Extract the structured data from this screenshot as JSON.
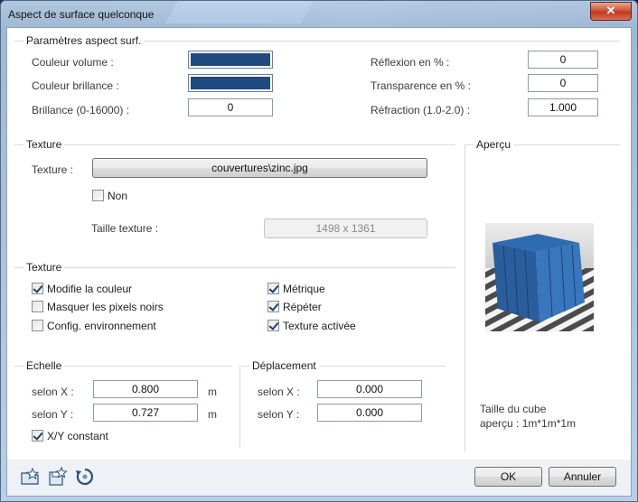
{
  "window": {
    "title": "Aspect de surface quelconque",
    "close_glyph": "✕"
  },
  "surface": {
    "group_title": "Paramètres aspect surf.",
    "couleur_volume_label": "Couleur volume :",
    "couleur_volume_color": "#1f4a7f",
    "couleur_brillance_label": "Couleur brillance :",
    "couleur_brillance_color": "#1f4a7f",
    "brillance_label": "Brillance (0-16000) :",
    "brillance_value": "0",
    "reflexion_label": "Réflexion en % :",
    "reflexion_value": "0",
    "transparence_label": "Transparence en % :",
    "transparence_value": "0",
    "refraction_label": "Réfraction (1.0-2.0) :",
    "refraction_value": "1.000"
  },
  "texture_file": {
    "group_title": "Texture",
    "texture_label": "Texture :",
    "texture_button": "couvertures\\zinc.jpg",
    "non_label": "Non",
    "non_checked": false,
    "taille_label": "Taille texture :",
    "taille_value": "1498 x 1361"
  },
  "texture_options": {
    "group_title": "Texture",
    "items": [
      {
        "label": "Modifie la couleur",
        "checked": true
      },
      {
        "label": "Masquer les pixels noirs",
        "checked": false
      },
      {
        "label": "Config. environnement",
        "checked": false
      },
      {
        "label": "Métrique",
        "checked": true
      },
      {
        "label": "Répéter",
        "checked": true
      },
      {
        "label": "Texture activée",
        "checked": true
      }
    ]
  },
  "echelle": {
    "group_title": "Echelle",
    "x_label": "selon X :",
    "x_value": "0.800",
    "x_unit": "m",
    "y_label": "selon Y :",
    "y_value": "0.727",
    "y_unit": "m",
    "constant_label": "X/Y constant",
    "constant_checked": true
  },
  "deplacement": {
    "group_title": "Déplacement",
    "x_label": "selon X :",
    "x_value": "0.000",
    "y_label": "selon Y :",
    "y_value": "0.000"
  },
  "apercu": {
    "group_title": "Aperçu",
    "caption_line1": "Taille du cube",
    "caption_line2": "aperçu : 1m*1m*1m"
  },
  "toolbar": {
    "icons": [
      "open-favorite-icon",
      "save-favorite-icon",
      "reset-icon"
    ]
  },
  "buttons": {
    "ok": "OK",
    "cancel": "Annuler"
  },
  "colors": {
    "accent": "#1f4a7f",
    "dialog_bg": "#ffffff",
    "frame": "#b9cfe6"
  }
}
